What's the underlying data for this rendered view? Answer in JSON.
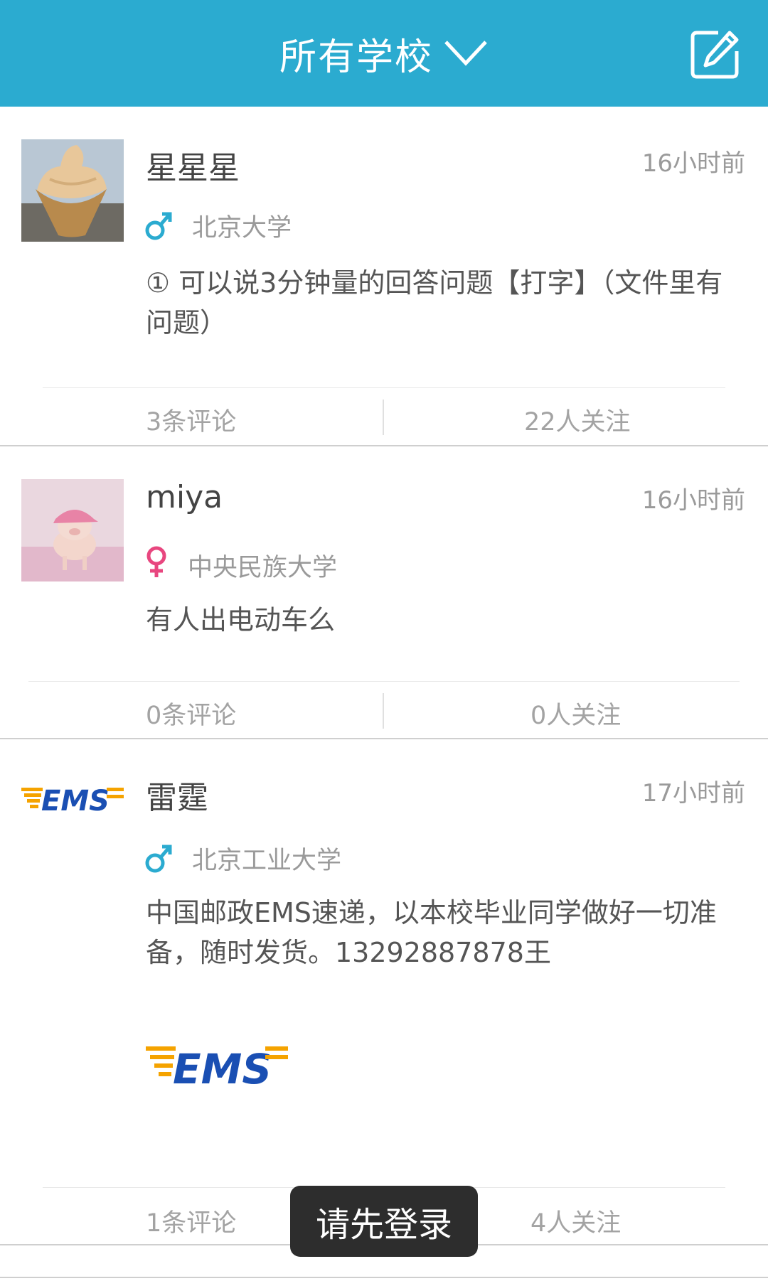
{
  "header": {
    "title": "所有学校",
    "chevron_icon": "chevron-down-icon",
    "compose_icon": "edit-icon"
  },
  "posts": [
    {
      "username": "星星星",
      "time": "16小时前",
      "gender": "male",
      "school": "北京大学",
      "content": "① 可以说3分钟量的回答问题【打字】（文件里有问题）",
      "comments": "3条评论",
      "follows": "22人关注",
      "avatar": "ice-cream-photo"
    },
    {
      "username": "miya",
      "time": "16小时前",
      "gender": "female",
      "school": "中央民族大学",
      "content": "有人出电动车么",
      "comments": "0条评论",
      "follows": "0人关注",
      "avatar": "pig-photo"
    },
    {
      "username": "雷霆",
      "time": "17小时前",
      "gender": "male",
      "school": "北京工业大学",
      "content": "中国邮政EMS速递，以本校毕业同学做好一切准备，随时发货。13292887878王",
      "comments": "1条评论",
      "follows": "4人关注",
      "avatar": "ems-logo"
    }
  ],
  "toast": {
    "text": "请先登录"
  },
  "logo": {
    "text": "EMS"
  },
  "colors": {
    "header": "#2babd0",
    "male": "#2babd0",
    "female": "#e8467f",
    "ems_blue": "#1a4fb3",
    "ems_orange": "#f5a300"
  }
}
